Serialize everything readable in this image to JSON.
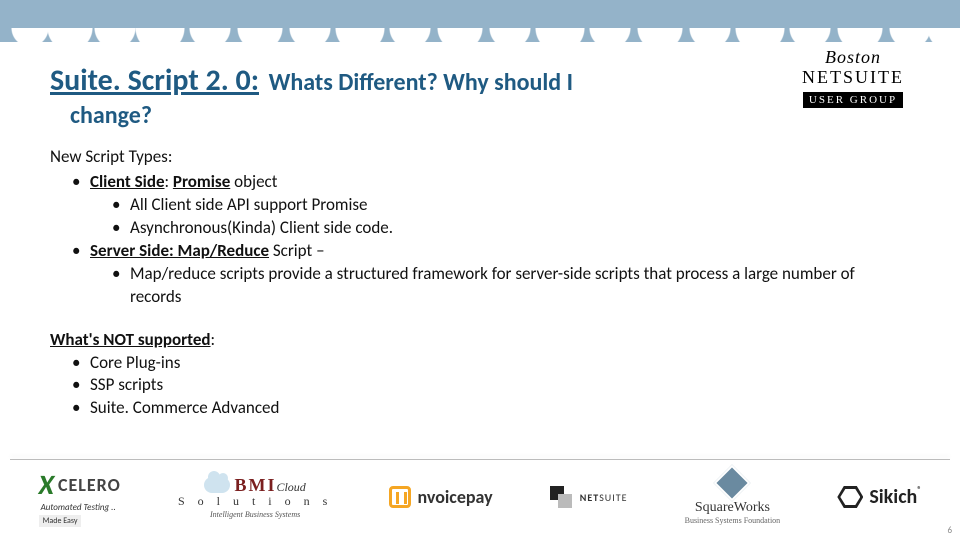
{
  "header_logo": {
    "city": "Boston",
    "product": "NETSUITE",
    "group": "USER GROUP"
  },
  "title": {
    "main": "Suite. Script 2. 0:",
    "rest": "Whats Different?  Why should I",
    "line2": "change?"
  },
  "section1": {
    "intro": "New Script Types:",
    "items": [
      {
        "label_bold": "Client Side",
        "label_after": ":  ",
        "emph": "Promise",
        "tail": " object",
        "children": [
          "All Client side API support Promise",
          "Asynchronous(Kinda) Client side code."
        ]
      },
      {
        "label_bold": "Server Side:  Map/Reduce",
        "label_after": " Script – ",
        "emph": "",
        "tail": "",
        "children": [
          "Map/reduce scripts provide a structured framework for server-side scripts that process a large number of records"
        ]
      }
    ]
  },
  "section2": {
    "heading": "What's NOT supported",
    "items": [
      "Core Plug-ins",
      "SSP scripts",
      "Suite. Commerce Advanced"
    ]
  },
  "footer_logos": {
    "xcelero": {
      "name": "CELERO",
      "sub": "Automated Testing ..",
      "tag": "Made Easy"
    },
    "bmi": {
      "big": "BMI",
      "cloud": "Cloud",
      "sol": "S o l u t i o n s",
      "sub": "Intelligent Business Systems"
    },
    "nvoicepay": "nvoicepay",
    "netsuite": {
      "a": "NET",
      "b": "SUITE"
    },
    "squareworks": {
      "name": "SquareWorks",
      "sub": "Business Systems Foundation"
    },
    "sikich": "Sikich"
  },
  "page_number": "6"
}
